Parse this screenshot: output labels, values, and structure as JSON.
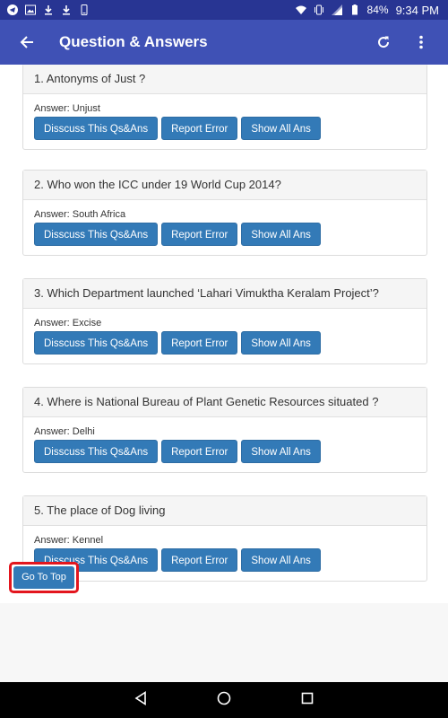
{
  "status_bar": {
    "battery": "84%",
    "time": "9:34 PM"
  },
  "app_bar": {
    "title": "Question & Answers"
  },
  "questions": [
    {
      "q": "1. Antonyms of Just ?",
      "answer": "Answer: Unjust"
    },
    {
      "q": "2. Who won the ICC under 19 World Cup 2014?",
      "answer": "Answer: South Africa"
    },
    {
      "q": "3. Which Department launched ‘Lahari Vimuktha Keralam Project’?",
      "answer": "Answer: Excise"
    },
    {
      "q": "4. Where is National Bureau of Plant Genetic Resources situated ?",
      "answer": "Answer: Delhi"
    },
    {
      "q": "5. The place of Dog living",
      "answer": "Answer: Kennel"
    }
  ],
  "buttons": {
    "discuss": "Disscuss This Qs&Ans",
    "report": "Report Error",
    "show_all": "Show All Ans"
  },
  "go_top": "Go To Top",
  "colors": {
    "status_bar": "#283593",
    "app_bar": "#3f51b5",
    "button": "#337ab7",
    "highlight": "#e3161e"
  }
}
